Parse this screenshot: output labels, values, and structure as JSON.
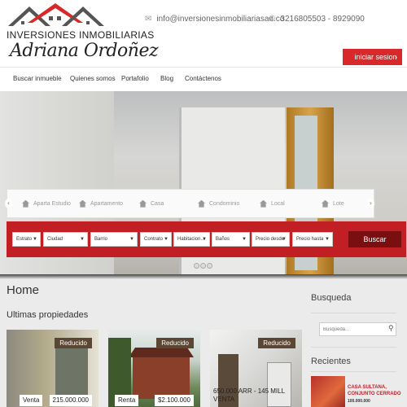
{
  "brand": {
    "line1": "INVERSIONES INMOBILIARIAS",
    "line2": "Adriana Ordoñez"
  },
  "contact": {
    "email": "info@inversionesinmobiliariasao.co",
    "phone": "3216805503 - 8929090"
  },
  "login": {
    "label": "iniciar sesion",
    "icon": "chevron-right-icon"
  },
  "nav": [
    "Buscar inmueble",
    "Quienes somos",
    "Portafolio",
    "Blog",
    "Contáctenos"
  ],
  "categories": [
    "Aparta Estudio",
    "Apartamento",
    "Casa",
    "Condominio",
    "Local",
    "Lote"
  ],
  "search": {
    "fields": [
      "Estrato",
      "Ciudad",
      "Barrio",
      "Contrato",
      "Habitacion...",
      "Baños",
      "Precio desde",
      "Precio hasta"
    ],
    "button": "Buscar"
  },
  "headings": {
    "home": "Home",
    "latest": "Ultimas propiedades"
  },
  "properties": [
    {
      "badge": "Reducido",
      "type": "Venta",
      "price": "215.000.000"
    },
    {
      "badge": "Reducido",
      "type": "Renta",
      "price": "$2.100.000"
    },
    {
      "badge": "Reducido",
      "caption1": "650.000 ARR - 145 MILL",
      "caption2": "VENTA"
    }
  ],
  "sidebar": {
    "search_title": "Busqueda",
    "search_placeholder": "Busqueda...",
    "recent_title": "Recientes",
    "recent_item": {
      "title": "CASA SULTANA, CONJUNTO CERRADO",
      "price": "100.000.000"
    }
  },
  "colors": {
    "accent": "#c21f25",
    "dark_accent": "#7a0f12",
    "badge": "#5a4632"
  }
}
